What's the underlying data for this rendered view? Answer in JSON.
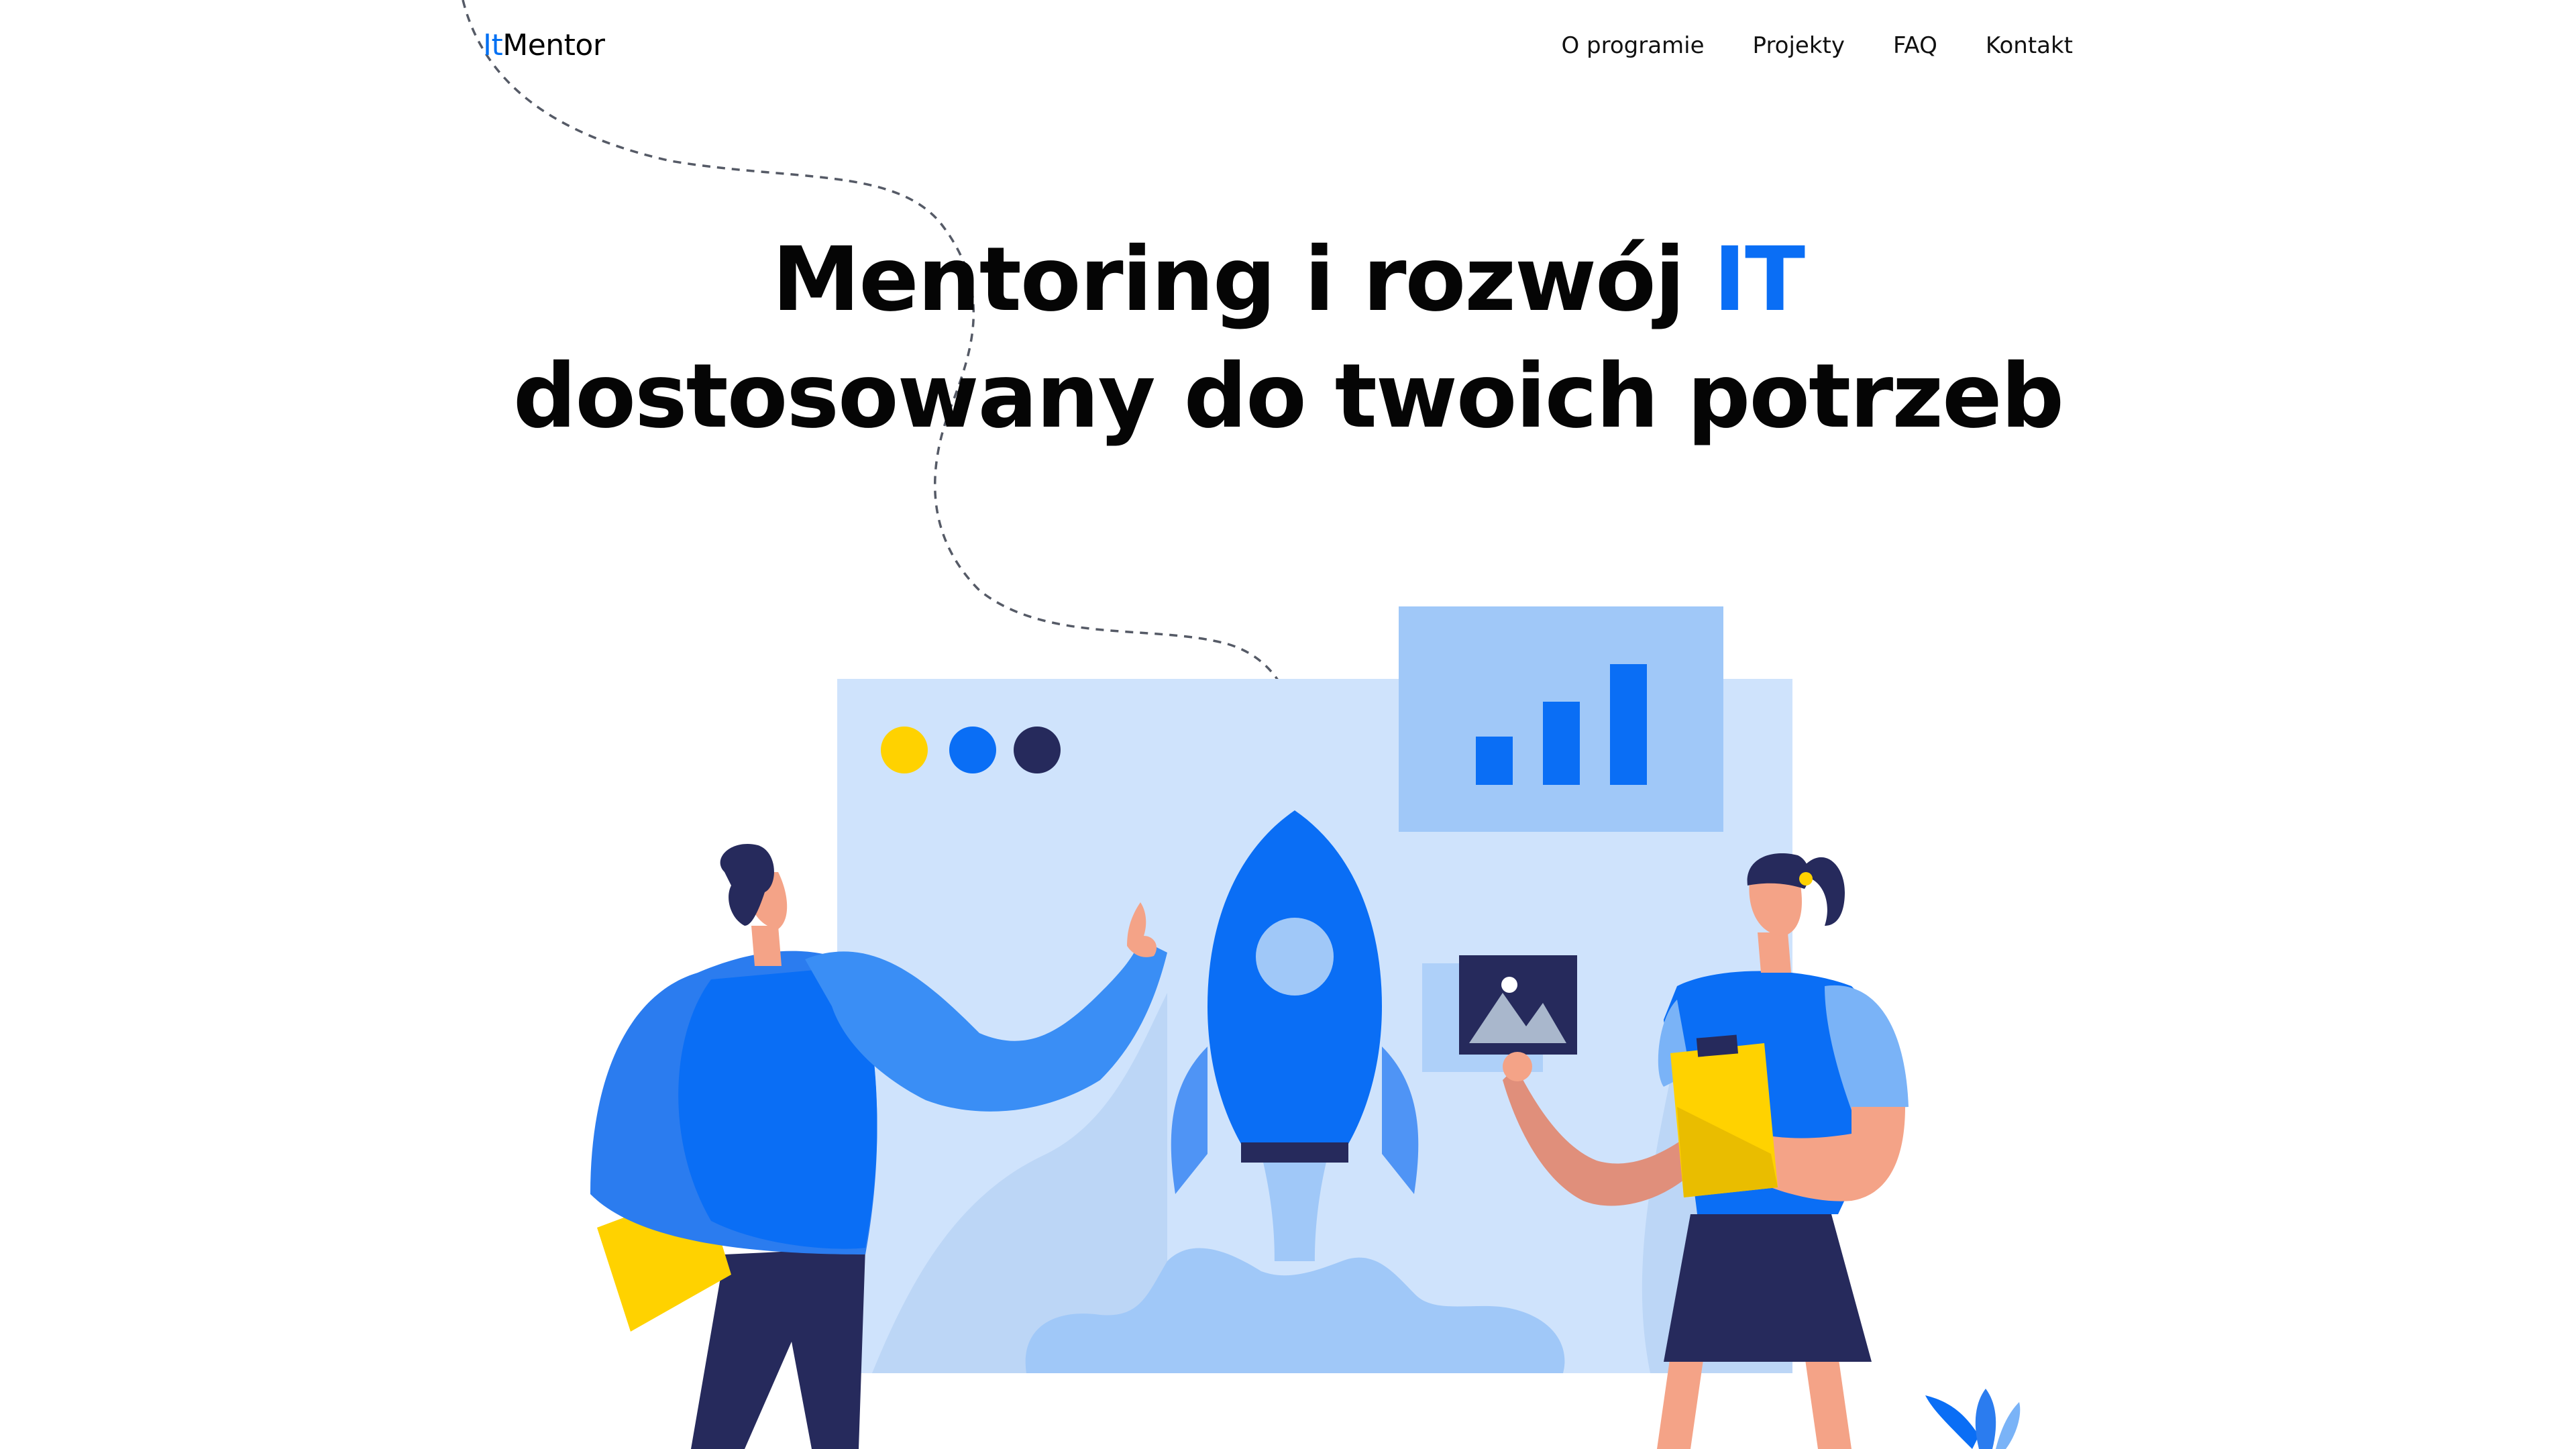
{
  "header": {
    "logo_prefix": "It",
    "logo_suffix": "Mentor",
    "nav": [
      {
        "label": "O programie"
      },
      {
        "label": "Projekty"
      },
      {
        "label": "FAQ"
      },
      {
        "label": "Kontakt"
      }
    ]
  },
  "hero": {
    "title_part1": "Mentoring i rozwój ",
    "title_accent": "IT",
    "title_line2": "dostosowany do twoich potrzeb"
  },
  "colors": {
    "accent": "#0a6ef5",
    "panel_light": "#cfe3fc",
    "panel_mid": "#a0c8f8",
    "navy": "#262a5c",
    "yellow": "#ffd200",
    "skin": "#f4a387"
  },
  "illustration": {
    "icons": [
      "window-dots-icon",
      "bar-chart-icon",
      "rocket-icon",
      "image-icon",
      "clipboard-icon",
      "plant-icon"
    ]
  }
}
